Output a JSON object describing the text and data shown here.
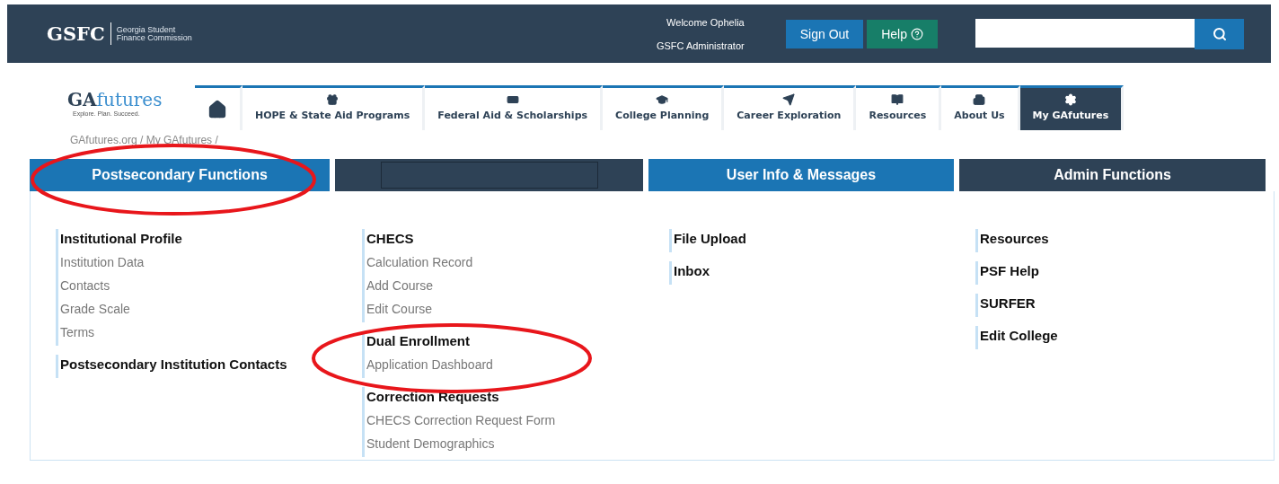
{
  "header": {
    "logo": "GSFC",
    "logo_subtitle": "Georgia Student Finance Commission",
    "welcome": "Welcome Ophelia",
    "role": "GSFC Administrator",
    "sign_out": "Sign Out",
    "help": "Help"
  },
  "site_logo": {
    "name_bold": "GA",
    "name_light": "futures",
    "tagline": "Explore. Plan. Succeed."
  },
  "nav_tabs": [
    {
      "selected": false
    },
    {
      "label": "HOPE & State Aid Programs",
      "selected": false
    },
    {
      "label": "Federal Aid & Scholarships",
      "selected": false
    },
    {
      "label": "College Planning",
      "selected": false
    },
    {
      "label": "Career Exploration",
      "selected": false
    },
    {
      "label": "Resources",
      "selected": false
    },
    {
      "label": "About Us",
      "selected": false
    },
    {
      "label": "My GAfutures",
      "selected": true
    }
  ],
  "breadcrumb": "GAfutures.org / My GAfutures /",
  "function_tabs": [
    {
      "kind": "label",
      "label": "Postsecondary Functions",
      "color": "#1b75b4"
    },
    {
      "kind": "field",
      "color": "#2e4256"
    },
    {
      "kind": "label",
      "label": "User Info & Messages",
      "color": "#1b75b4"
    },
    {
      "kind": "label",
      "label": "Admin Functions",
      "color": "#2e4256"
    }
  ],
  "columns": [
    [
      {
        "heading": "Institutional Profile",
        "items": [
          "Institution Data",
          "Contacts",
          "Grade Scale",
          "Terms"
        ]
      },
      {
        "heading": "Postsecondary Institution Contacts"
      }
    ],
    [
      {
        "heading": "CHECS",
        "items": [
          "Calculation Record",
          "Add Course",
          "Edit Course"
        ]
      },
      {
        "heading": "Dual Enrollment",
        "items": [
          "Application Dashboard"
        ]
      },
      {
        "heading": "Correction Requests",
        "items": [
          "CHECS Correction Request Form",
          "Student Demographics"
        ]
      }
    ],
    [
      {
        "heading": "File Upload"
      },
      {
        "heading": "Inbox"
      }
    ],
    [
      {
        "heading": "Resources"
      },
      {
        "heading": "PSF Help"
      },
      {
        "heading": "SURFER"
      },
      {
        "heading": "Edit College"
      }
    ]
  ],
  "highlight_marks": [
    {
      "kind": "ellipse"
    },
    {
      "kind": "ellipse"
    }
  ]
}
